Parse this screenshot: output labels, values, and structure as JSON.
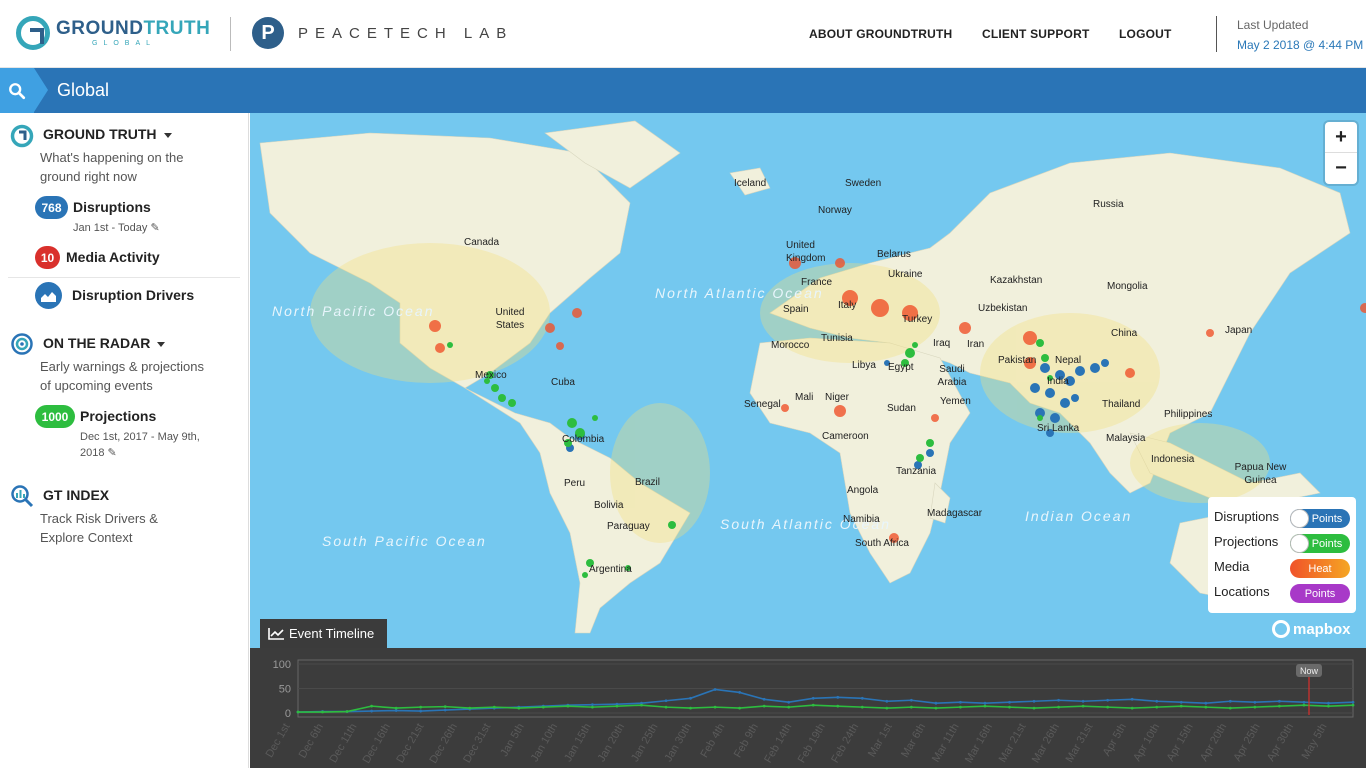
{
  "header": {
    "gt_logo": {
      "word1_a": "GROUND",
      "word1_b": "TRUTH",
      "word2": "GLOBAL"
    },
    "pt_logo": {
      "mark": "P",
      "text": "PEACETECH LAB"
    },
    "nav": [
      {
        "label": "ABOUT GROUNDTRUTH"
      },
      {
        "label": "CLIENT SUPPORT"
      },
      {
        "label": "LOGOUT"
      }
    ],
    "last_updated_label": "Last Updated",
    "last_updated_value": "May 2 2018 @ 4:44 PM"
  },
  "region_bar": {
    "title": "Global",
    "search_icon": "search-icon"
  },
  "sidebar": {
    "ground_truth": {
      "title": "GROUND TRUTH",
      "desc": "What's happening on the ground right now",
      "disruptions": {
        "count": "768",
        "label": "Disruptions",
        "date": "Jan 1st - Today"
      },
      "media": {
        "count": "10",
        "label": "Media Activity"
      },
      "drivers": {
        "label": "Disruption Drivers"
      }
    },
    "radar": {
      "title": "ON THE RADAR",
      "desc": "Early warnings & projections of upcoming events",
      "projections": {
        "count": "1000",
        "label": "Projections",
        "date": "Dec 1st, 2017 - May 9th, 2018"
      }
    },
    "gt_index": {
      "title": "GT INDEX",
      "desc": "Track Risk Drivers & Explore Context"
    }
  },
  "map": {
    "countries": [
      "Iceland",
      "Sweden",
      "Norway",
      "Russia",
      "Canada",
      "United Kingdom",
      "Belarus",
      "Ukraine",
      "France",
      "Kazakhstan",
      "Mongolia",
      "Spain",
      "Italy",
      "Uzbekistan",
      "Turkey",
      "United States",
      "China",
      "Japan",
      "Morocco",
      "Tunisia",
      "Iraq",
      "Iran",
      "Pakistan",
      "Nepal",
      "Mexico",
      "Cuba",
      "Libya",
      "Egypt",
      "Saudi Arabia",
      "Senegal",
      "Mali",
      "Niger",
      "Sudan",
      "Yemen",
      "India",
      "Thailand",
      "Philippines",
      "Colombia",
      "Cameroon",
      "Sri Lanka",
      "Malaysia",
      "Tanzania",
      "Indonesia",
      "Papua New Guinea",
      "Peru",
      "Brazil",
      "Bolivia",
      "Angola",
      "Paraguay",
      "Namibia",
      "Madagascar",
      "South Africa",
      "Argentina"
    ],
    "oceans": [
      "North Pacific Ocean",
      "North Atlantic Ocean",
      "South Atlantic Ocean",
      "South Pacific Ocean",
      "Indian Ocean"
    ],
    "zoom_in": "+",
    "zoom_out": "−",
    "legend": [
      {
        "label": "Disruptions",
        "toggle": "Points",
        "color": "#2a74b6",
        "knob": true
      },
      {
        "label": "Projections",
        "toggle": "Points",
        "color": "#2dbd3f",
        "knob": true
      },
      {
        "label": "Media",
        "toggle": "Heat",
        "color": "#f0522a",
        "knob": false
      },
      {
        "label": "Locations",
        "toggle": "Points",
        "color": "#a839c8",
        "knob": false
      }
    ],
    "attribution": "mapbox"
  },
  "timeline": {
    "tab_label": "Event Timeline",
    "y_ticks": [
      "100",
      "50",
      "0"
    ],
    "now_label": "Now",
    "dates": [
      "Dec 1st",
      "Dec 6th",
      "Dec 11th",
      "Dec 16th",
      "Dec 21st",
      "Dec 26th",
      "Dec 31st",
      "Jan 5th",
      "Jan 10th",
      "Jan 15th",
      "Jan 20th",
      "Jan 25th",
      "Jan 30th",
      "Feb 4th",
      "Feb 9th",
      "Feb 14th",
      "Feb 19th",
      "Feb 24th",
      "Mar 1st",
      "Mar 6th",
      "Mar 11th",
      "Mar 16th",
      "Mar 21st",
      "Mar 26th",
      "Mar 31st",
      "Apr 5th",
      "Apr 10th",
      "Apr 15th",
      "Apr 20th",
      "Apr 25th",
      "Apr 30th",
      "May 5th"
    ],
    "colors": {
      "disruptions": "#2a74b6",
      "projections": "#2dbd3f",
      "now": "#d9302c"
    }
  },
  "chart_data": {
    "type": "line",
    "ylim": [
      0,
      100
    ],
    "series": [
      {
        "values": [
          2,
          3,
          3,
          4,
          5,
          4,
          6,
          8,
          10,
          12,
          14,
          16,
          17,
          18,
          20,
          25,
          30,
          48,
          42,
          28,
          22,
          30,
          32,
          30,
          24,
          26,
          20,
          22,
          20,
          22,
          24,
          26,
          24,
          26,
          28,
          24,
          22,
          20,
          24,
          22,
          24,
          22,
          20,
          22
        ]
      },
      {
        "values": [
          2,
          2,
          3,
          14,
          10,
          12,
          13,
          10,
          12,
          10,
          12,
          14,
          12,
          14,
          16,
          12,
          10,
          12,
          10,
          14,
          12,
          16,
          14,
          12,
          10,
          12,
          10,
          12,
          14,
          12,
          10,
          12,
          14,
          12,
          10,
          12,
          14,
          12,
          10,
          12,
          14,
          16,
          14,
          16
        ]
      }
    ]
  }
}
